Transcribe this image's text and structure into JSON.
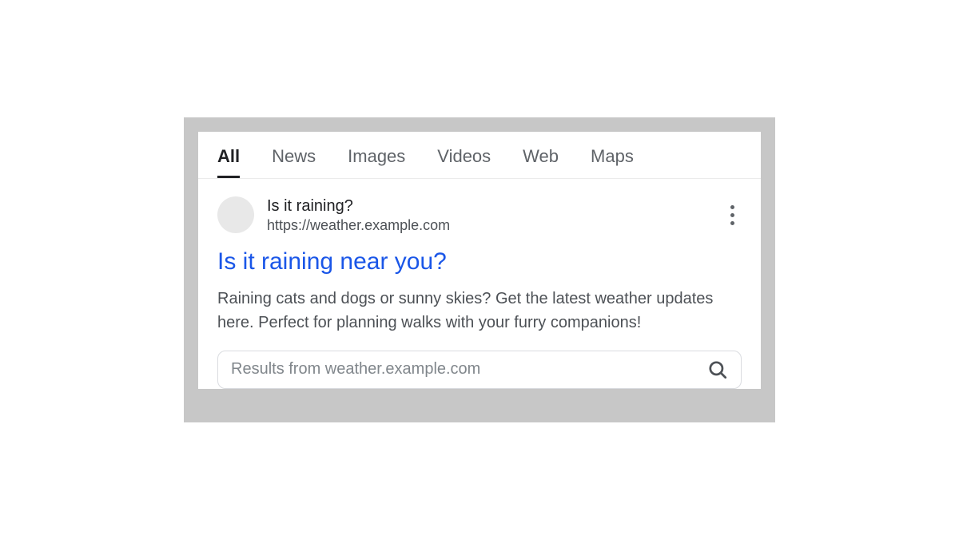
{
  "tabs": {
    "all": "All",
    "news": "News",
    "images": "Images",
    "videos": "Videos",
    "web": "Web",
    "maps": "Maps"
  },
  "result": {
    "site_name": "Is it raining?",
    "site_url": "https://weather.example.com",
    "title": "Is it raining near you?",
    "snippet": "Raining cats and dogs or sunny skies? Get the latest weather updates here. Perfect for planning walks with your furry companions!",
    "sitelinks_placeholder": "Results from weather.example.com"
  }
}
